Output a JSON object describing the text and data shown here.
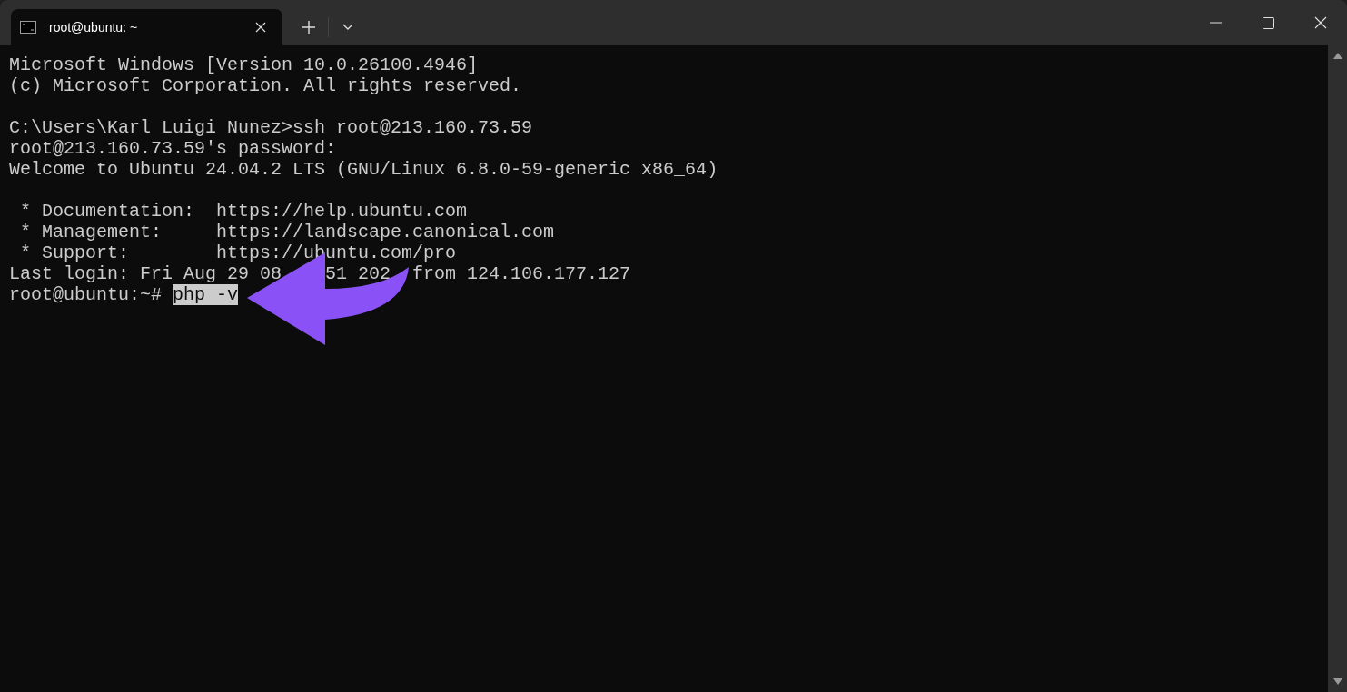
{
  "tab": {
    "title": "root@ubuntu: ~",
    "selected": true
  },
  "lines": [
    {
      "kind": "text",
      "text": "Microsoft Windows [Version 10.0.26100.4946]"
    },
    {
      "kind": "text",
      "text": "(c) Microsoft Corporation. All rights reserved."
    },
    {
      "kind": "blank"
    },
    {
      "kind": "text",
      "text": "C:\\Users\\Karl Luigi Nunez>ssh root@213.160.73.59"
    },
    {
      "kind": "text",
      "text": "root@213.160.73.59's password:"
    },
    {
      "kind": "text",
      "text": "Welcome to Ubuntu 24.04.2 LTS (GNU/Linux 6.8.0-59-generic x86_64)"
    },
    {
      "kind": "blank"
    },
    {
      "kind": "text",
      "text": " * Documentation:  https://help.ubuntu.com"
    },
    {
      "kind": "text",
      "text": " * Management:     https://landscape.canonical.com"
    },
    {
      "kind": "text",
      "text": " * Support:        https://ubuntu.com/pro"
    },
    {
      "kind": "partial",
      "segments": [
        "Last login: Fri Aug 29 08",
        "51 202",
        "from 124.106.177.127"
      ]
    },
    {
      "kind": "prompt",
      "prompt": "root@ubuntu:~# ",
      "command": "php -v",
      "selected": true
    }
  ]
}
